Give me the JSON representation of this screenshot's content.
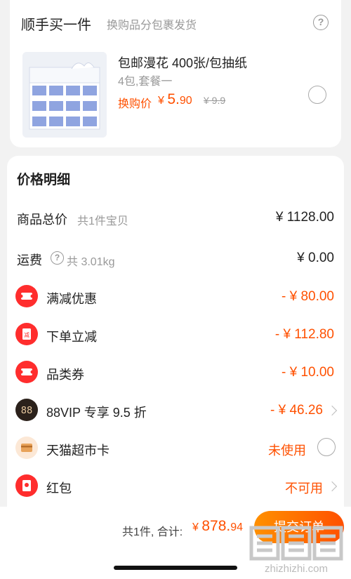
{
  "addon": {
    "title": "顺手买一件",
    "subtitle": "换购品分包裹发货",
    "product": {
      "name": "包邮漫花 400张/包抽纸",
      "spec": "4包,套餐一",
      "price_label": "换购价",
      "currency": "¥",
      "price_int": "5.",
      "price_dec": "90",
      "old_price": "¥ 9.9",
      "selected": false
    }
  },
  "breakdown": {
    "title": "价格明细",
    "goods_label": "商品总价",
    "goods_sub": "共1件宝贝",
    "goods_value": "¥ 1128.00",
    "shipping_label": "运费",
    "shipping_sub": "共 3.01kg",
    "shipping_value": "¥ 0.00",
    "items": [
      {
        "label": "满减优惠",
        "value": "- ¥ 80.00",
        "icon": "coupon-ticket-icon",
        "color": "#ff2d2d"
      },
      {
        "label": "下单立减",
        "value": "- ¥ 112.80",
        "icon": "instant-discount-icon",
        "color": "#ff2d2d"
      },
      {
        "label": "品类券",
        "value": "- ¥ 10.00",
        "icon": "category-coupon-icon",
        "color": "#ff2d2d"
      },
      {
        "label": "88VIP 专享 9.5 折",
        "value": "- ¥ 46.26",
        "icon": "88vip-icon",
        "color": "#3a2a20"
      }
    ],
    "tmall_card_label": "天猫超市卡",
    "tmall_card_value": "未使用",
    "redpacket_label": "红包",
    "redpacket_value": "不可用"
  },
  "footer": {
    "total_text": "共1件, 合计:",
    "currency": "¥",
    "total_int": "878.",
    "total_dec": "94",
    "submit_label": "提交订单",
    "watermark": "zhizhizhi.com"
  },
  "colors": {
    "accent": "#ff5000",
    "red": "#ff2d2d"
  }
}
